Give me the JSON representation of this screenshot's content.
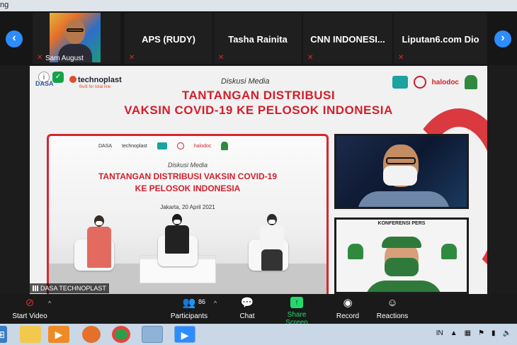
{
  "top_strip": {
    "title": "ng"
  },
  "participants": [
    {
      "name": "Sam August",
      "muted": true,
      "has_photo": true
    },
    {
      "name": "APS (RUDY)",
      "muted": true
    },
    {
      "name": "Tasha Rainita",
      "muted": true
    },
    {
      "name": "CNN  INDONESI...",
      "muted": true
    },
    {
      "name": "Liputan6.com Dio",
      "muted": true
    }
  ],
  "nav": {
    "prev_icon": "chevron-left-icon",
    "next_icon": "chevron-right-icon"
  },
  "stage": {
    "organizer_logo_1": "DASA",
    "organizer_logo_2": "technoplast",
    "organizer_logo_2_tag": "Built for total line",
    "event_type": "Diskusi Media",
    "title_line1": "TANTANGAN DISTRIBUSI",
    "title_line2": "VAKSIN COVID-19 KE PELOSOK INDONESIA",
    "partner_logo_halodoc": "halodoc",
    "backdrop": {
      "logos": [
        "DASA",
        "technoplast",
        "halodoc"
      ],
      "event_type": "Diskusi Media",
      "title_line1": "TANTANGAN DISTRIBUSI VAKSIN COVID-19",
      "title_line2": "KE PELOSOK INDONESIA",
      "date": "Jakarta, 20 April 2021"
    },
    "video_tile_2_caption": "KONFERENSI PERS",
    "speaker_label": "DASA TECHNOPLAST"
  },
  "toolbar": {
    "start_video": "Start Video",
    "participants": "Participants",
    "participants_count": "86",
    "chat": "Chat",
    "share_screen": "Share Screen",
    "record": "Record",
    "reactions": "Reactions",
    "colors": {
      "share": "#23d96c",
      "muted": "#e02828",
      "accent": "#2d8cff"
    }
  },
  "taskbar": {
    "language": "IN"
  }
}
